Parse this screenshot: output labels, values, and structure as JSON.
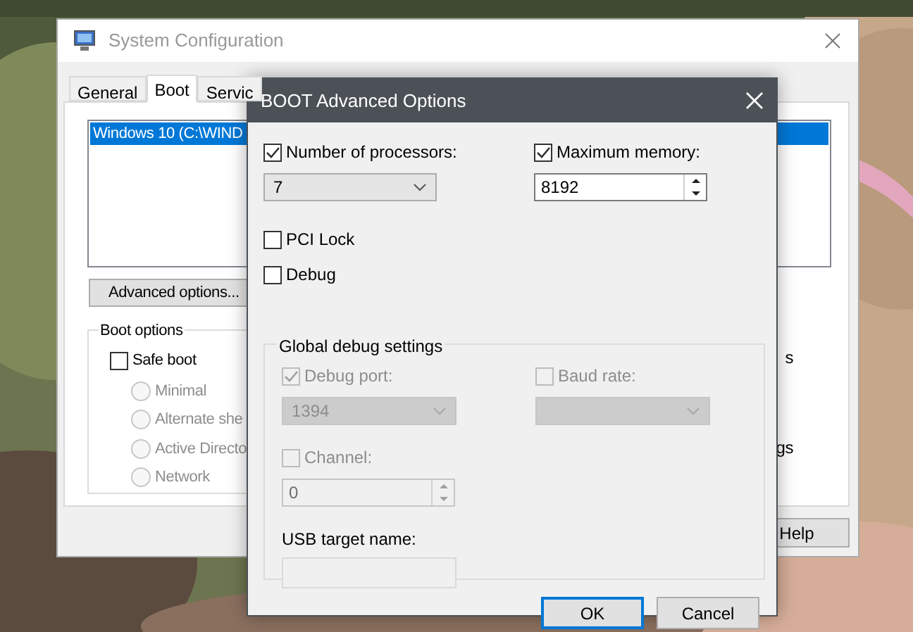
{
  "window": {
    "title": "System Configuration",
    "tabs": [
      {
        "label": "General",
        "selected": false
      },
      {
        "label": "Boot",
        "selected": true
      },
      {
        "label": "Servic",
        "selected": false
      }
    ],
    "boot_entries": [
      {
        "label": "Windows 10 (C:\\WIND",
        "selected": true
      }
    ],
    "advanced_button": "Advanced options...",
    "boot_options": {
      "title": "Boot options",
      "safe_boot": {
        "label": "Safe boot",
        "checked": false
      },
      "modes": [
        {
          "label": "Minimal",
          "selected": false,
          "disabled": true
        },
        {
          "label": "Alternate she",
          "selected": false,
          "disabled": true
        },
        {
          "label": "Active Directo",
          "selected": false,
          "disabled": true
        },
        {
          "label": "Network",
          "selected": false,
          "disabled": true
        }
      ]
    },
    "right_column": [
      "s",
      "gs"
    ],
    "help_button": "Help"
  },
  "dialog": {
    "title": "BOOT Advanced Options",
    "processors": {
      "label": "Number of processors:",
      "checked": true,
      "value": "7"
    },
    "memory": {
      "label": "Maximum memory:",
      "checked": true,
      "value": "8192"
    },
    "pci_lock": {
      "label": "PCI Lock",
      "checked": false
    },
    "debug": {
      "label": "Debug",
      "checked": false
    },
    "debug_settings": {
      "title": "Global debug settings",
      "debug_port": {
        "label": "Debug port:",
        "checked": true,
        "disabled": true,
        "value": "1394"
      },
      "baud_rate": {
        "label": "Baud rate:",
        "checked": false,
        "disabled": true
      },
      "channel": {
        "label": "Channel:",
        "checked": false,
        "disabled": true,
        "value": "0"
      },
      "usb_target": {
        "label": "USB target name:"
      }
    },
    "buttons": [
      {
        "label": "OK",
        "default": true
      },
      {
        "label": "Cancel",
        "default": false
      }
    ]
  }
}
